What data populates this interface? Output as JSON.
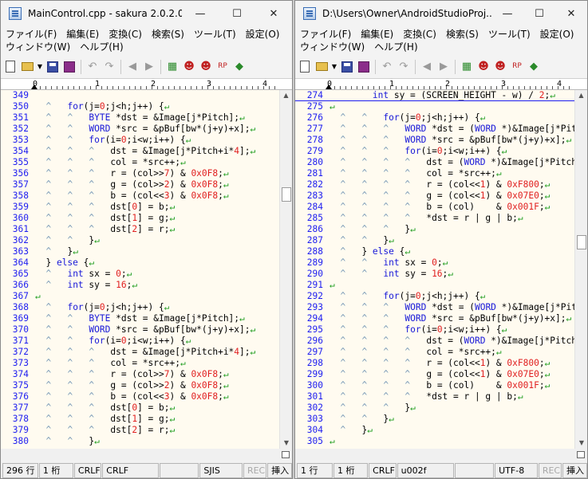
{
  "left": {
    "title": "MainControl.cpp - sakura 2.0.2.0",
    "menu_row1": [
      "ファイル(F)",
      "編集(E)",
      "変換(C)",
      "検索(S)",
      "ツール(T)",
      "設定(O)"
    ],
    "menu_row2": [
      "ウィンドウ(W)",
      "ヘルプ(H)"
    ],
    "ruler": [
      "0",
      "1",
      "2",
      "3",
      "4"
    ],
    "lines": [
      {
        "n": "349",
        "c": ""
      },
      {
        "n": "350",
        "c": "  ^   for(j=0;j<h;j++) {↵"
      },
      {
        "n": "351",
        "c": "  ^   ^   BYTE *dst = &Image[j*Pitch];↵"
      },
      {
        "n": "352",
        "c": "  ^   ^   WORD *src = &pBuf[bw*(j+y)+x];↵"
      },
      {
        "n": "353",
        "c": "  ^   ^   for(i=0;i<w;i++) {↵"
      },
      {
        "n": "354",
        "c": "  ^   ^   ^   dst = &Image[j*Pitch+i*4];↵"
      },
      {
        "n": "355",
        "c": "  ^   ^   ^   col = *src++;↵"
      },
      {
        "n": "356",
        "c": "  ^   ^   ^   r = (col>>7) & 0x0F8;↵"
      },
      {
        "n": "357",
        "c": "  ^   ^   ^   g = (col>>2) & 0x0F8;↵"
      },
      {
        "n": "358",
        "c": "  ^   ^   ^   b = (col<<3) & 0x0F8;↵"
      },
      {
        "n": "359",
        "c": "  ^   ^   ^   dst[0] = b;↵"
      },
      {
        "n": "360",
        "c": "  ^   ^   ^   dst[1] = g;↵"
      },
      {
        "n": "361",
        "c": "  ^   ^   ^   dst[2] = r;↵"
      },
      {
        "n": "362",
        "c": "  ^   ^   }↵"
      },
      {
        "n": "363",
        "c": "  ^   }↵"
      },
      {
        "n": "364",
        "c": "  } else {↵"
      },
      {
        "n": "365",
        "c": "  ^   int sx = 0;↵"
      },
      {
        "n": "366",
        "c": "  ^   int sy = 16;↵"
      },
      {
        "n": "367",
        "c": "↵"
      },
      {
        "n": "368",
        "c": "  ^   for(j=0;j<h;j++) {↵"
      },
      {
        "n": "369",
        "c": "  ^   ^   BYTE *dst = &Image[j*Pitch];↵"
      },
      {
        "n": "370",
        "c": "  ^   ^   WORD *src = &pBuf[bw*(j+y)+x];↵"
      },
      {
        "n": "371",
        "c": "  ^   ^   for(i=0;i<w;i++) {↵"
      },
      {
        "n": "372",
        "c": "  ^   ^   ^   dst = &Image[j*Pitch+i*4];↵"
      },
      {
        "n": "373",
        "c": "  ^   ^   ^   col = *src++;↵"
      },
      {
        "n": "374",
        "c": "  ^   ^   ^   r = (col>>7) & 0x0F8;↵"
      },
      {
        "n": "375",
        "c": "  ^   ^   ^   g = (col>>2) & 0x0F8;↵"
      },
      {
        "n": "376",
        "c": "  ^   ^   ^   b = (col<<3) & 0x0F8;↵"
      },
      {
        "n": "377",
        "c": "  ^   ^   ^   dst[0] = b;↵"
      },
      {
        "n": "378",
        "c": "  ^   ^   ^   dst[1] = g;↵"
      },
      {
        "n": "379",
        "c": "  ^   ^   ^   dst[2] = r;↵"
      },
      {
        "n": "380",
        "c": "  ^   ^   }↵"
      }
    ],
    "status": [
      "296 行",
      "1 桁",
      "CRLF",
      "CRLF",
      "",
      "SJIS",
      "REC",
      "挿入"
    ]
  },
  "right": {
    "title": "D:\\Users\\Owner\\AndroidStudioProj...",
    "menu_row1": [
      "ファイル(F)",
      "編集(E)",
      "変換(C)",
      "検索(S)",
      "ツール(T)",
      "設定(O)"
    ],
    "menu_row2": [
      "ウィンドウ(W)",
      "ヘルプ(H)"
    ],
    "ruler": [
      "0",
      "1",
      "2",
      "3",
      "4"
    ],
    "lines": [
      {
        "n": "274",
        "c": "        int sy = (SCREEN_HEIGHT - w) / 2;↵"
      },
      {
        "n": "275",
        "c": "↵"
      },
      {
        "n": "276",
        "c": "  ^   ^   for(j=0;j<h;j++) {↵"
      },
      {
        "n": "277",
        "c": "  ^   ^   ^   WORD *dst = (WORD *)&Image[j*Pitc"
      },
      {
        "n": "278",
        "c": "  ^   ^   ^   WORD *src = &pBuf[bw*(j+y)+x];↵"
      },
      {
        "n": "279",
        "c": "  ^   ^   ^   for(i=0;i<w;i++) {↵"
      },
      {
        "n": "280",
        "c": "  ^   ^   ^   ^   dst = (WORD *)&Image[j*Pitch+"
      },
      {
        "n": "281",
        "c": "  ^   ^   ^   ^   col = *src++;↵"
      },
      {
        "n": "282",
        "c": "  ^   ^   ^   ^   r = (col<<1) & 0xF800;↵"
      },
      {
        "n": "283",
        "c": "  ^   ^   ^   ^   g = (col<<1) & 0x07E0;↵"
      },
      {
        "n": "284",
        "c": "  ^   ^   ^   ^   b = (col)    & 0x001F;↵"
      },
      {
        "n": "285",
        "c": "  ^   ^   ^   ^   *dst = r | g | b;↵"
      },
      {
        "n": "286",
        "c": "  ^   ^   ^   }↵"
      },
      {
        "n": "287",
        "c": "  ^   ^   }↵"
      },
      {
        "n": "288",
        "c": "  ^   } else {↵"
      },
      {
        "n": "289",
        "c": "  ^   ^   int sx = 0;↵"
      },
      {
        "n": "290",
        "c": "  ^   ^   int sy = 16;↵"
      },
      {
        "n": "291",
        "c": "↵"
      },
      {
        "n": "292",
        "c": "  ^   ^   for(j=0;j<h;j++) {↵"
      },
      {
        "n": "293",
        "c": "  ^   ^   ^   WORD *dst = (WORD *)&Image[j*Pitc"
      },
      {
        "n": "294",
        "c": "  ^   ^   ^   WORD *src = &pBuf[bw*(j+y)+x];↵"
      },
      {
        "n": "295",
        "c": "  ^   ^   ^   for(i=0;i<w;i++) {↵"
      },
      {
        "n": "296",
        "c": "  ^   ^   ^   ^   dst = (WORD *)&Image[j*Pitch+"
      },
      {
        "n": "297",
        "c": "  ^   ^   ^   ^   col = *src++;↵"
      },
      {
        "n": "298",
        "c": "  ^   ^   ^   ^   r = (col<<1) & 0xF800;↵"
      },
      {
        "n": "299",
        "c": "  ^   ^   ^   ^   g = (col<<1) & 0x07E0;↵"
      },
      {
        "n": "300",
        "c": "  ^   ^   ^   ^   b = (col)    & 0x001F;↵"
      },
      {
        "n": "301",
        "c": "  ^   ^   ^   ^   *dst = r | g | b;↵"
      },
      {
        "n": "302",
        "c": "  ^   ^   ^   }↵"
      },
      {
        "n": "303",
        "c": "  ^   ^   }↵"
      },
      {
        "n": "304",
        "c": "  ^   }↵"
      },
      {
        "n": "305",
        "c": "↵"
      }
    ],
    "status": [
      "1 行",
      "1 桁",
      "CRLF",
      "u002f",
      "",
      "UTF-8",
      "REC",
      "挿入"
    ]
  },
  "icons": {
    "minimize": "minimize-icon",
    "maximize": "maximize-icon",
    "close": "close-icon",
    "toolbar": [
      "new-file-icon",
      "open-folder-icon",
      "save-icon",
      "save-as-icon",
      "undo-icon",
      "redo-icon",
      "jump-back-icon",
      "jump-forward-icon",
      "grep-icon",
      "find-prev-icon",
      "find-next-icon",
      "replace-icon",
      "mark-icon"
    ]
  },
  "colors": {
    "editor_bg": "#fffbf0",
    "line_number": "#1d1df0",
    "keyword": "#1818d8",
    "number": "#e02020",
    "eol_mark": "#1d9c1d",
    "tab_mark": "#7a9bb8"
  }
}
